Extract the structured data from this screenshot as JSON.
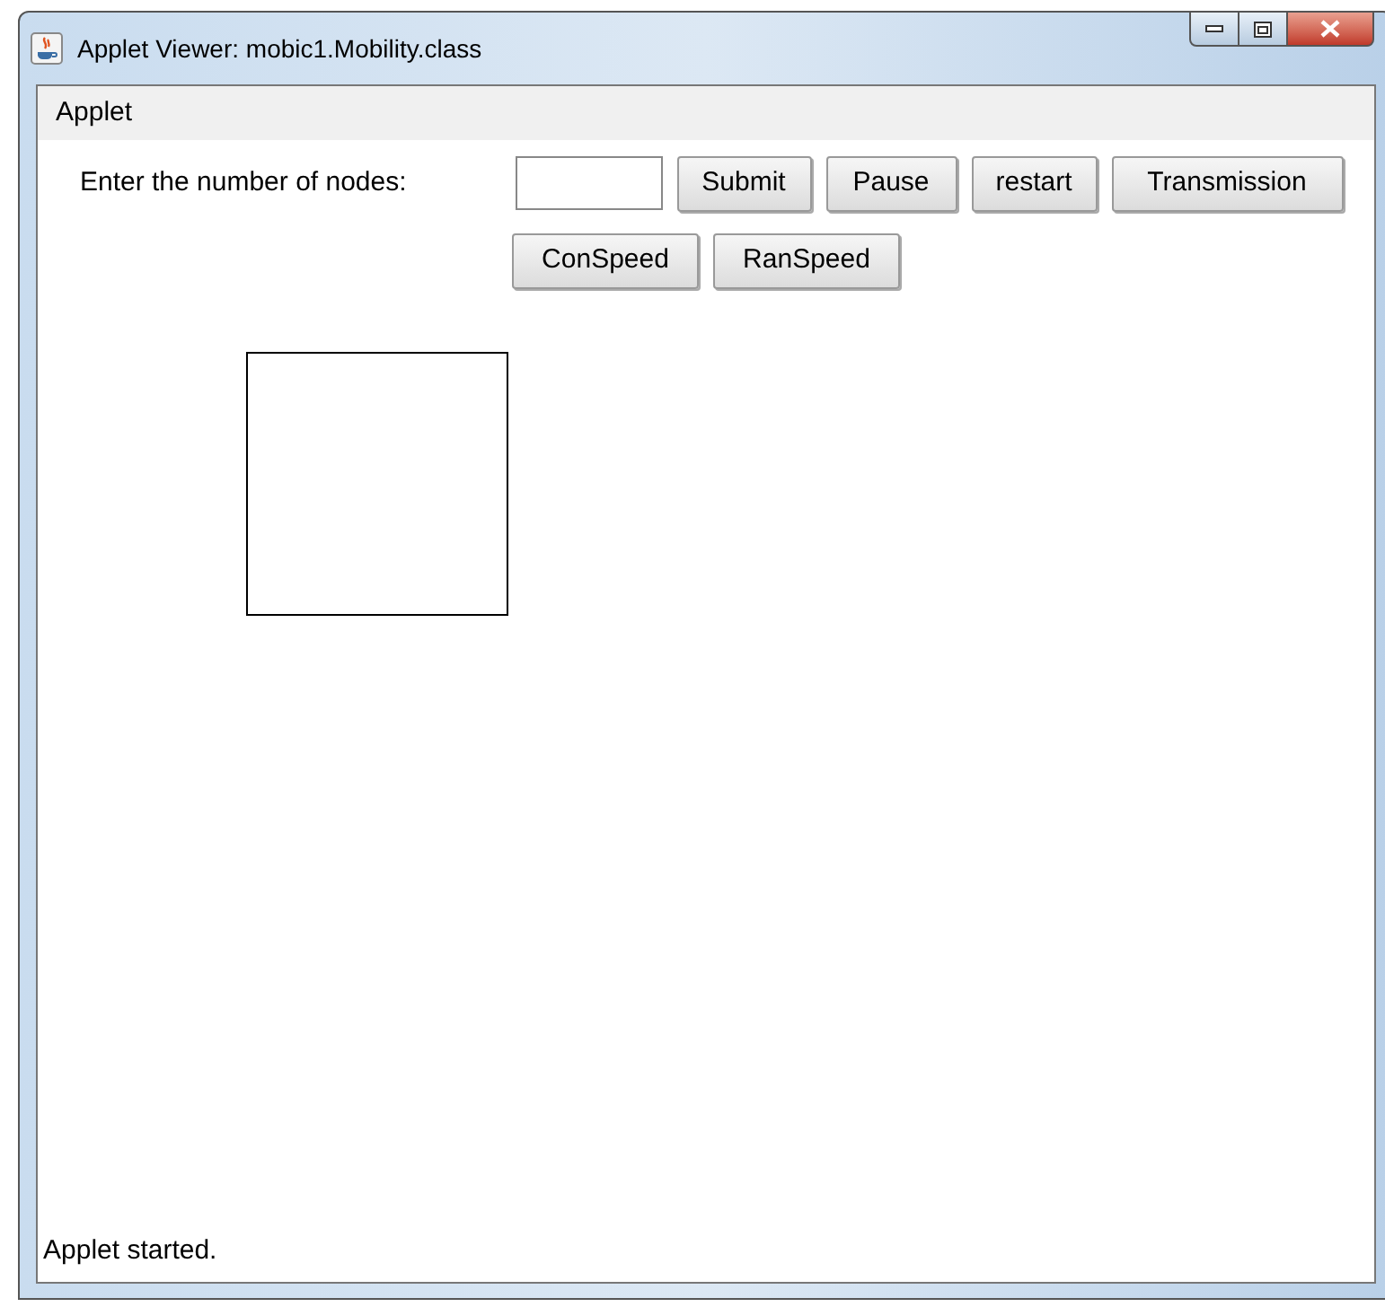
{
  "window": {
    "title": "Applet Viewer: mobic1.Mobility.class"
  },
  "menu_bar": {
    "items": [
      "Applet"
    ]
  },
  "controls": [
    {
      "kind": "label",
      "text": "Enter the number of nodes:"
    },
    {
      "kind": "field"
    },
    {
      "kind": "button",
      "text": "Submit"
    },
    {
      "kind": "button",
      "text": "Pause"
    },
    {
      "kind": "button",
      "text": "restart"
    },
    {
      "kind": "button",
      "text": "Transmission"
    },
    {
      "kind": "button",
      "text": "ConSpeed"
    },
    {
      "kind": "button",
      "text": "RanSpeed"
    }
  ],
  "status_bar": "Applet started."
}
